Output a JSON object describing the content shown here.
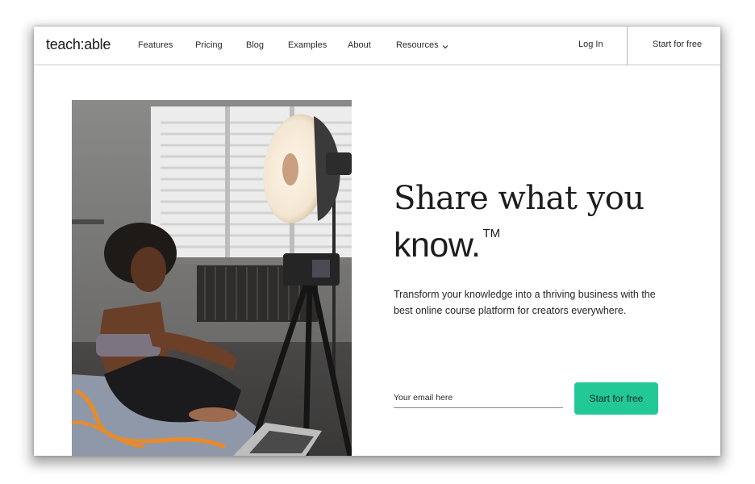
{
  "nav": {
    "logo": "teach:able",
    "links": [
      {
        "label": "Features"
      },
      {
        "label": "Pricing"
      },
      {
        "label": "Blog"
      },
      {
        "label": "Examples"
      },
      {
        "label": "About"
      },
      {
        "label": "Resources",
        "icon": "chevron-down-icon"
      }
    ],
    "login_label": "Log In",
    "start_label": "Start for free"
  },
  "hero": {
    "title_line1": "Share what you",
    "title_line2": "know.",
    "trademark": "TM",
    "subtitle": "Transform your knowledge into a thriving business with the best online course platform for creators everywhere.",
    "email_placeholder": "Your email here",
    "email_value": "",
    "cta_label": "Start for free",
    "image_alt": "Woman sitting on a yoga mat in front of a camera on a tripod and a studio light"
  },
  "colors": {
    "accent": "#22c997",
    "text": "#1d1d1d",
    "divider": "#c8c8c8"
  }
}
